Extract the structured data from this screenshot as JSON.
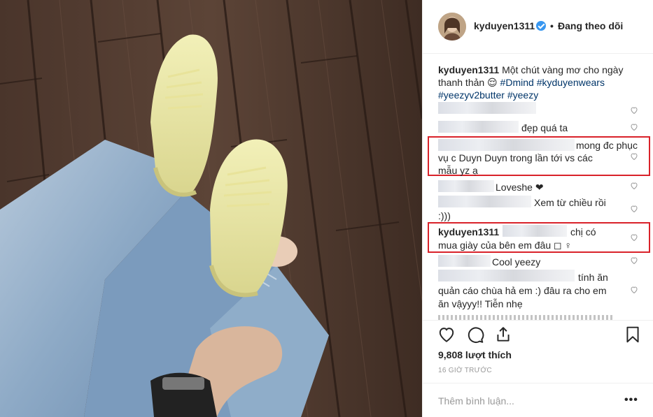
{
  "header": {
    "username": "kyduyen1311",
    "dot": "•",
    "follow_status": "Đang theo dõi"
  },
  "caption": {
    "username": "kyduyen1311",
    "text": "Một chút vàng mơ cho ngày thanh thản 😌",
    "tags": [
      "#Dmind",
      "#kyduyenwears",
      "#yeezyv2butter",
      "#yeezy"
    ]
  },
  "comments": [
    {
      "text": ""
    },
    {
      "text": "đẹp quá ta"
    },
    {
      "line1": "mong đc phục",
      "line2": "vụ c Duyn Duyn trong lần tới vs các",
      "line3": "mẫu yz ạ"
    },
    {
      "text": "Loveshe ❤"
    },
    {
      "line1": "Xem từ chiều rồi",
      "line2": ":)))"
    },
    {
      "username": "kyduyen1311",
      "line1": "chị có",
      "line2": "mua giày của bên em đâu ◻ ♀"
    },
    {
      "text": "Cool yeezy"
    },
    {
      "line1": "tính ăn",
      "line2": "quản cáo chùa hả em :) đâu ra cho em",
      "line3": "ăn vậyyy!! Tiễn nhẹ"
    }
  ],
  "actions": {
    "icons": [
      "heart-icon",
      "comment-icon",
      "share-icon",
      "bookmark-icon"
    ],
    "likes": "9,808 lượt thích",
    "time": "16 GIỜ TRƯỚC"
  },
  "add_comment": {
    "placeholder": "Thêm bình luận...",
    "more": "•••"
  },
  "colors": {
    "accent": "#3897f0",
    "hashtag": "#003569",
    "highlight_box": "#d9222a",
    "muted": "#999999"
  }
}
